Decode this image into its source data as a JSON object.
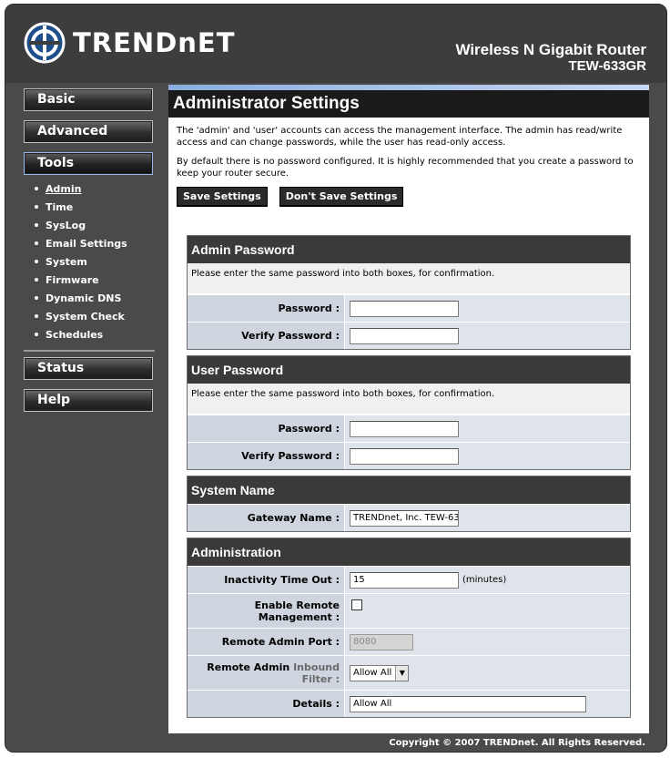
{
  "header": {
    "logo_text": "TRENDnET",
    "product_name": "Wireless N Gigabit Router",
    "model": "TEW-633GR"
  },
  "sidebar": {
    "buttons": {
      "basic": "Basic",
      "advanced": "Advanced",
      "tools": "Tools",
      "status": "Status",
      "help": "Help"
    },
    "tools_items": [
      "Admin",
      "Time",
      "SysLog",
      "Email Settings",
      "System",
      "Firmware",
      "Dynamic DNS",
      "System Check",
      "Schedules"
    ],
    "current_item": "Admin"
  },
  "page": {
    "title": "Administrator Settings",
    "intro_1": "The 'admin' and 'user' accounts can access the management interface. The admin has read/write access and can change passwords, while the user has read-only access.",
    "intro_2": "By default there is no password configured. It is highly recommended that you create a password to keep your router secure.",
    "save_label": "Save Settings",
    "dont_save_label": "Don't Save Settings"
  },
  "admin_password": {
    "heading": "Admin Password",
    "note": "Please enter the same password into both boxes, for confirmation.",
    "password_label": "Password :",
    "verify_label": "Verify Password :",
    "password_value": "",
    "verify_value": ""
  },
  "user_password": {
    "heading": "User Password",
    "note": "Please enter the same password into both boxes, for confirmation.",
    "password_label": "Password :",
    "verify_label": "Verify Password :",
    "password_value": "",
    "verify_value": ""
  },
  "system_name": {
    "heading": "System Name",
    "gateway_label": "Gateway Name :",
    "gateway_value": "TRENDnet, Inc. TEW-63"
  },
  "administration": {
    "heading": "Administration",
    "timeout_label": "Inactivity Time Out :",
    "timeout_value": "15",
    "timeout_unit": "(minutes)",
    "remote_label_1": "Enable Remote",
    "remote_label_2": "Management :",
    "remote_enabled": false,
    "port_label": "Remote Admin Port :",
    "port_value": "8080",
    "filter_label_1": "Remote Admin",
    "filter_label_grey": "Inbound",
    "filter_label_2": "Filter :",
    "filter_value": "Allow All",
    "details_label": "Details :",
    "details_value": "Allow All"
  },
  "footer": {
    "copyright": "Copyright © 2007 TRENDnet. All Rights Reserved."
  }
}
